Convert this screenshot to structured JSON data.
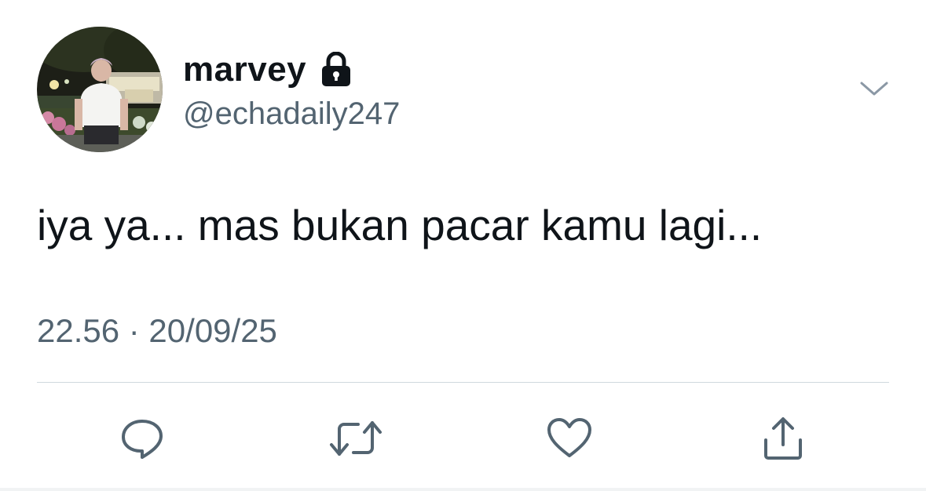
{
  "tweet": {
    "display_name": "marvey",
    "handle": "@echadaily247",
    "text": "iya ya... mas bukan pacar kamu lagi...",
    "timestamp": "22.56 · 20/09/25",
    "protected_icon": "lock-icon",
    "menu_icon": "chevron-down-icon"
  },
  "actions": [
    {
      "name": "reply",
      "icon": "reply-icon"
    },
    {
      "name": "retweet",
      "icon": "retweet-icon"
    },
    {
      "name": "like",
      "icon": "heart-icon"
    },
    {
      "name": "share",
      "icon": "share-icon"
    }
  ],
  "colors": {
    "text_primary": "#0f1419",
    "text_secondary": "#536471",
    "divider": "#cfd9de",
    "icon": "#536471"
  }
}
